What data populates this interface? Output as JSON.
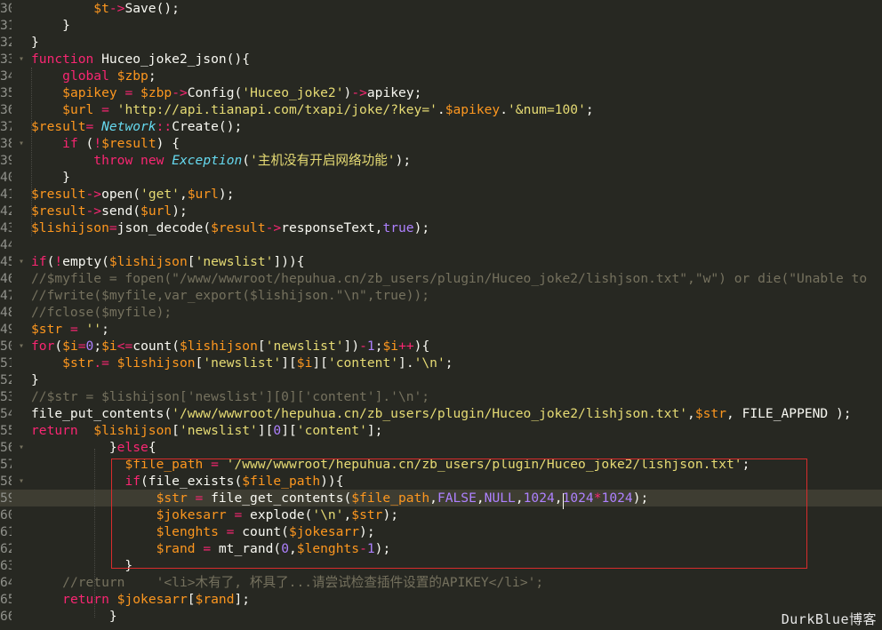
{
  "editor": {
    "watermark": "DurkBlue博客",
    "active_line": 59,
    "lines": [
      {
        "n": "30",
        "fold": "",
        "tokens": [
          {
            "t": "        "
          },
          {
            "t": "$t",
            "c": "var"
          },
          {
            "t": "->",
            "c": "op"
          },
          {
            "t": "Save();"
          }
        ]
      },
      {
        "n": "31",
        "fold": "",
        "tokens": [
          {
            "t": "    }"
          }
        ]
      },
      {
        "n": "32",
        "fold": "",
        "tokens": [
          {
            "t": "}"
          }
        ]
      },
      {
        "n": "33",
        "fold": "▾",
        "tokens": [
          {
            "t": "function",
            "c": "kw"
          },
          {
            "t": " Huceo_joke2_json(){"
          }
        ]
      },
      {
        "n": "34",
        "fold": "",
        "tokens": [
          {
            "t": "    "
          },
          {
            "t": "global",
            "c": "kw"
          },
          {
            "t": " "
          },
          {
            "t": "$zbp",
            "c": "var"
          },
          {
            "t": ";"
          }
        ]
      },
      {
        "n": "35",
        "fold": "",
        "tokens": [
          {
            "t": "    "
          },
          {
            "t": "$apikey",
            "c": "var"
          },
          {
            "t": " = ",
            "c": "op"
          },
          {
            "t": "$zbp",
            "c": "var"
          },
          {
            "t": "->",
            "c": "op"
          },
          {
            "t": "Config("
          },
          {
            "t": "'Huceo_joke2'",
            "c": "str"
          },
          {
            "t": ")"
          },
          {
            "t": "->",
            "c": "op"
          },
          {
            "t": "apikey;"
          }
        ]
      },
      {
        "n": "36",
        "fold": "",
        "tokens": [
          {
            "t": "    "
          },
          {
            "t": "$url",
            "c": "var"
          },
          {
            "t": " = ",
            "c": "op"
          },
          {
            "t": "'http://api.tianapi.com/txapi/joke/?key='",
            "c": "str"
          },
          {
            "t": "."
          },
          {
            "t": "$apikey",
            "c": "var"
          },
          {
            "t": "."
          },
          {
            "t": "'&num=100'",
            "c": "str"
          },
          {
            "t": ";"
          }
        ]
      },
      {
        "n": "37",
        "fold": "",
        "tokens": [
          {
            "t": "$result",
            "c": "var"
          },
          {
            "t": "= ",
            "c": "op"
          },
          {
            "t": "Network",
            "c": "cls"
          },
          {
            "t": "::",
            "c": "op"
          },
          {
            "t": "Create();"
          }
        ]
      },
      {
        "n": "38",
        "fold": "▾",
        "tokens": [
          {
            "t": "    "
          },
          {
            "t": "if",
            "c": "kw"
          },
          {
            "t": " ("
          },
          {
            "t": "!",
            "c": "op"
          },
          {
            "t": "$result",
            "c": "var"
          },
          {
            "t": ") {"
          }
        ]
      },
      {
        "n": "39",
        "fold": "",
        "tokens": [
          {
            "t": "        "
          },
          {
            "t": "throw",
            "c": "kw"
          },
          {
            "t": " "
          },
          {
            "t": "new",
            "c": "kw"
          },
          {
            "t": " "
          },
          {
            "t": "Exception",
            "c": "cls"
          },
          {
            "t": "("
          },
          {
            "t": "'主机没有开启网络功能'",
            "c": "str"
          },
          {
            "t": ");"
          }
        ]
      },
      {
        "n": "40",
        "fold": "",
        "tokens": [
          {
            "t": "    }"
          }
        ]
      },
      {
        "n": "41",
        "fold": "",
        "tokens": [
          {
            "t": "$result",
            "c": "var"
          },
          {
            "t": "->",
            "c": "op"
          },
          {
            "t": "open("
          },
          {
            "t": "'get'",
            "c": "str"
          },
          {
            "t": ","
          },
          {
            "t": "$url",
            "c": "var"
          },
          {
            "t": ");"
          }
        ]
      },
      {
        "n": "42",
        "fold": "",
        "tokens": [
          {
            "t": "$result",
            "c": "var"
          },
          {
            "t": "->",
            "c": "op"
          },
          {
            "t": "send("
          },
          {
            "t": "$url",
            "c": "var"
          },
          {
            "t": ");"
          }
        ]
      },
      {
        "n": "43",
        "fold": "",
        "tokens": [
          {
            "t": "$lishijson",
            "c": "var"
          },
          {
            "t": "=",
            "c": "op"
          },
          {
            "t": "json_decode("
          },
          {
            "t": "$result",
            "c": "var"
          },
          {
            "t": "->",
            "c": "op"
          },
          {
            "t": "responseText,"
          },
          {
            "t": "true",
            "c": "num"
          },
          {
            "t": ");"
          }
        ]
      },
      {
        "n": "44",
        "fold": "",
        "tokens": []
      },
      {
        "n": "45",
        "fold": "▾",
        "tokens": [
          {
            "t": "if",
            "c": "kw"
          },
          {
            "t": "("
          },
          {
            "t": "!",
            "c": "op"
          },
          {
            "t": "empty("
          },
          {
            "t": "$lishijson",
            "c": "var"
          },
          {
            "t": "["
          },
          {
            "t": "'newslist'",
            "c": "str"
          },
          {
            "t": "])){"
          }
        ]
      },
      {
        "n": "46",
        "fold": "",
        "tokens": [
          {
            "t": "//$myfile = fopen(\"/www/wwwroot/hepuhua.cn/zb_users/plugin/Huceo_joke2/lishjson.txt\",\"w\") or die(\"Unable to",
            "c": "cm"
          }
        ]
      },
      {
        "n": "47",
        "fold": "",
        "tokens": [
          {
            "t": "//fwrite($myfile,var_export($lishijson.\"\\n\",true));",
            "c": "cm"
          }
        ]
      },
      {
        "n": "48",
        "fold": "",
        "tokens": [
          {
            "t": "//fclose($myfile);",
            "c": "cm"
          }
        ]
      },
      {
        "n": "49",
        "fold": "",
        "tokens": [
          {
            "t": "$str",
            "c": "var"
          },
          {
            "t": " = ",
            "c": "op"
          },
          {
            "t": "''",
            "c": "str"
          },
          {
            "t": ";"
          }
        ]
      },
      {
        "n": "50",
        "fold": "▾",
        "tokens": [
          {
            "t": "for",
            "c": "kw"
          },
          {
            "t": "("
          },
          {
            "t": "$i",
            "c": "var"
          },
          {
            "t": "=",
            "c": "op"
          },
          {
            "t": "0",
            "c": "num"
          },
          {
            "t": ";"
          },
          {
            "t": "$i",
            "c": "var"
          },
          {
            "t": "<=",
            "c": "op"
          },
          {
            "t": "count("
          },
          {
            "t": "$lishijson",
            "c": "var"
          },
          {
            "t": "["
          },
          {
            "t": "'newslist'",
            "c": "str"
          },
          {
            "t": "])"
          },
          {
            "t": "-",
            "c": "op"
          },
          {
            "t": "1",
            "c": "num"
          },
          {
            "t": ";"
          },
          {
            "t": "$i",
            "c": "var"
          },
          {
            "t": "++",
            "c": "op"
          },
          {
            "t": "){"
          }
        ]
      },
      {
        "n": "51",
        "fold": "",
        "tokens": [
          {
            "t": "    "
          },
          {
            "t": "$str",
            "c": "var"
          },
          {
            "t": ".= ",
            "c": "op"
          },
          {
            "t": "$lishijson",
            "c": "var"
          },
          {
            "t": "["
          },
          {
            "t": "'newslist'",
            "c": "str"
          },
          {
            "t": "]["
          },
          {
            "t": "$i",
            "c": "var"
          },
          {
            "t": "]["
          },
          {
            "t": "'content'",
            "c": "str"
          },
          {
            "t": "]."
          },
          {
            "t": "'\\n'",
            "c": "str"
          },
          {
            "t": ";"
          }
        ]
      },
      {
        "n": "52",
        "fold": "",
        "tokens": [
          {
            "t": "}"
          }
        ]
      },
      {
        "n": "53",
        "fold": "",
        "tokens": [
          {
            "t": "//$str = $lishijson['newslist'][0]['content'].'\\n';",
            "c": "cm"
          }
        ]
      },
      {
        "n": "54",
        "fold": "",
        "tokens": [
          {
            "t": "file_put_contents("
          },
          {
            "t": "'/www/wwwroot/hepuhua.cn/zb_users/plugin/Huceo_joke2/lishjson.txt'",
            "c": "str"
          },
          {
            "t": ","
          },
          {
            "t": "$str",
            "c": "var"
          },
          {
            "t": ", FILE_APPEND );"
          }
        ]
      },
      {
        "n": "55",
        "fold": "",
        "tokens": [
          {
            "t": "return",
            "c": "kw"
          },
          {
            "t": "  "
          },
          {
            "t": "$lishijson",
            "c": "var"
          },
          {
            "t": "["
          },
          {
            "t": "'newslist'",
            "c": "str"
          },
          {
            "t": "]["
          },
          {
            "t": "0",
            "c": "num"
          },
          {
            "t": "]["
          },
          {
            "t": "'content'",
            "c": "str"
          },
          {
            "t": "];"
          }
        ]
      },
      {
        "n": "56",
        "fold": "▾",
        "tokens": [
          {
            "t": "          }"
          },
          {
            "t": "else",
            "c": "kw"
          },
          {
            "t": "{"
          }
        ]
      },
      {
        "n": "57",
        "fold": "",
        "tokens": [
          {
            "t": "            "
          },
          {
            "t": "$file_path",
            "c": "var"
          },
          {
            "t": " = ",
            "c": "op"
          },
          {
            "t": "'/www/wwwroot/hepuhua.cn/zb_users/plugin/Huceo_joke2/lishjson.txt'",
            "c": "str"
          },
          {
            "t": ";"
          }
        ]
      },
      {
        "n": "58",
        "fold": "▾",
        "tokens": [
          {
            "t": "            "
          },
          {
            "t": "if",
            "c": "kw"
          },
          {
            "t": "(file_exists("
          },
          {
            "t": "$file_path",
            "c": "var"
          },
          {
            "t": ")){"
          }
        ]
      },
      {
        "n": "59",
        "fold": "",
        "tokens": [
          {
            "t": "                "
          },
          {
            "t": "$str",
            "c": "var"
          },
          {
            "t": " = ",
            "c": "op"
          },
          {
            "t": "file_get_contents("
          },
          {
            "t": "$file_path",
            "c": "var"
          },
          {
            "t": ","
          },
          {
            "t": "FALSE",
            "c": "num"
          },
          {
            "t": ","
          },
          {
            "t": "NULL",
            "c": "num"
          },
          {
            "t": ","
          },
          {
            "t": "1024",
            "c": "num"
          },
          {
            "t": ","
          },
          {
            "t": "1024",
            "c": "num"
          },
          {
            "t": "*",
            "c": "op"
          },
          {
            "t": "1024",
            "c": "num"
          },
          {
            "t": ");"
          }
        ]
      },
      {
        "n": "60",
        "fold": "",
        "tokens": [
          {
            "t": "                "
          },
          {
            "t": "$jokesarr",
            "c": "var"
          },
          {
            "t": " = ",
            "c": "op"
          },
          {
            "t": "explode("
          },
          {
            "t": "'\\n'",
            "c": "str"
          },
          {
            "t": ","
          },
          {
            "t": "$str",
            "c": "var"
          },
          {
            "t": ");"
          }
        ]
      },
      {
        "n": "61",
        "fold": "",
        "tokens": [
          {
            "t": "                "
          },
          {
            "t": "$lenghts",
            "c": "var"
          },
          {
            "t": " = ",
            "c": "op"
          },
          {
            "t": "count("
          },
          {
            "t": "$jokesarr",
            "c": "var"
          },
          {
            "t": ");"
          }
        ]
      },
      {
        "n": "62",
        "fold": "",
        "tokens": [
          {
            "t": "                "
          },
          {
            "t": "$rand",
            "c": "var"
          },
          {
            "t": " = ",
            "c": "op"
          },
          {
            "t": "mt_rand("
          },
          {
            "t": "0",
            "c": "num"
          },
          {
            "t": ","
          },
          {
            "t": "$lenghts",
            "c": "var"
          },
          {
            "t": "-",
            "c": "op"
          },
          {
            "t": "1",
            "c": "num"
          },
          {
            "t": ");"
          }
        ]
      },
      {
        "n": "63",
        "fold": "",
        "tokens": [
          {
            "t": "            }"
          }
        ]
      },
      {
        "n": "64",
        "fold": "",
        "tokens": [
          {
            "t": "    "
          },
          {
            "t": "//return    '<li>木有了, 杯具了...请尝试检查插件设置的APIKEY</li>';",
            "c": "cm"
          }
        ]
      },
      {
        "n": "65",
        "fold": "",
        "tokens": [
          {
            "t": "    "
          },
          {
            "t": "return",
            "c": "kw"
          },
          {
            "t": " "
          },
          {
            "t": "$jokesarr",
            "c": "var"
          },
          {
            "t": "["
          },
          {
            "t": "$rand",
            "c": "var"
          },
          {
            "t": "];"
          }
        ]
      },
      {
        "n": "66",
        "fold": "",
        "tokens": [
          {
            "t": "          }"
          }
        ]
      }
    ]
  }
}
